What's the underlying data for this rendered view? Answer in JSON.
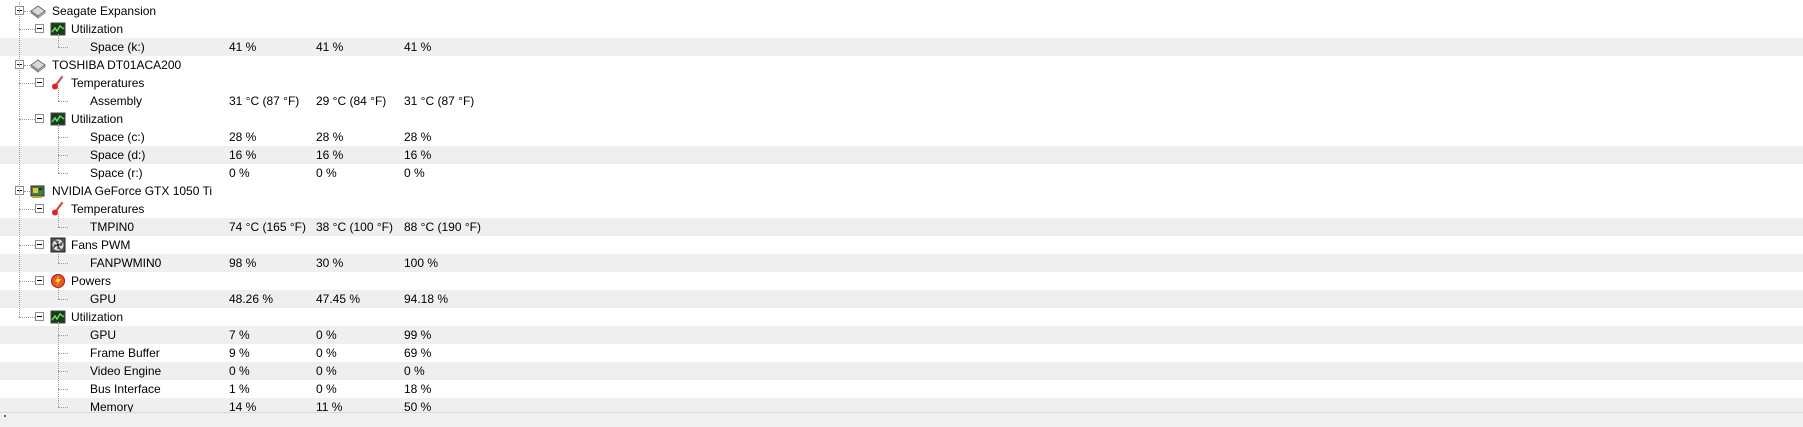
{
  "tree": [
    {
      "label": "Seagate Expansion",
      "level": 0,
      "icon": "drive-icon",
      "expanded": true
    },
    {
      "label": "Utilization",
      "level": 1,
      "icon": "utilization-icon",
      "expanded": true
    },
    {
      "label": "Space (k:)",
      "level": 2,
      "values": [
        "41 %",
        "41 %",
        "41 %"
      ]
    },
    {
      "label": "TOSHIBA DT01ACA200",
      "level": 0,
      "icon": "drive-icon",
      "expanded": true
    },
    {
      "label": "Temperatures",
      "level": 1,
      "icon": "thermometer-icon",
      "expanded": true
    },
    {
      "label": "Assembly",
      "level": 2,
      "values": [
        "31 °C  (87 °F)",
        "29 °C  (84 °F)",
        "31 °C  (87 °F)"
      ]
    },
    {
      "label": "Utilization",
      "level": 1,
      "icon": "utilization-icon",
      "expanded": true
    },
    {
      "label": "Space (c:)",
      "level": 2,
      "values": [
        "28 %",
        "28 %",
        "28 %"
      ]
    },
    {
      "label": "Space (d:)",
      "level": 2,
      "values": [
        "16 %",
        "16 %",
        "16 %"
      ]
    },
    {
      "label": "Space (r:)",
      "level": 2,
      "values": [
        "0 %",
        "0 %",
        "0 %"
      ]
    },
    {
      "label": "NVIDIA GeForce GTX 1050 Ti",
      "level": 0,
      "icon": "gpu-icon",
      "expanded": true
    },
    {
      "label": "Temperatures",
      "level": 1,
      "icon": "thermometer-icon",
      "expanded": true
    },
    {
      "label": "TMPIN0",
      "level": 2,
      "values": [
        "74 °C  (165 °F)",
        "38 °C  (100 °F)",
        "88 °C  (190 °F)"
      ]
    },
    {
      "label": "Fans PWM",
      "level": 1,
      "icon": "fan-icon",
      "expanded": true
    },
    {
      "label": "FANPWMIN0",
      "level": 2,
      "values": [
        "98 %",
        "30 %",
        "100 %"
      ]
    },
    {
      "label": "Powers",
      "level": 1,
      "icon": "power-icon",
      "expanded": true
    },
    {
      "label": "GPU",
      "level": 2,
      "values": [
        "48.26 %",
        "47.45 %",
        "94.18 %"
      ]
    },
    {
      "label": "Utilization",
      "level": 1,
      "icon": "utilization-icon",
      "expanded": true
    },
    {
      "label": "GPU",
      "level": 2,
      "values": [
        "7 %",
        "0 %",
        "99 %"
      ]
    },
    {
      "label": "Frame Buffer",
      "level": 2,
      "values": [
        "9 %",
        "0 %",
        "69 %"
      ]
    },
    {
      "label": "Video Engine",
      "level": 2,
      "values": [
        "0 %",
        "0 %",
        "0 %"
      ]
    },
    {
      "label": "Bus Interface",
      "level": 2,
      "values": [
        "1 %",
        "0 %",
        "18 %"
      ]
    },
    {
      "label": "Memory",
      "level": 2,
      "values": [
        "14 %",
        "11 %",
        "50 %"
      ]
    }
  ],
  "colors": {
    "row_alt": "#efefef",
    "tree_line": "#9a9a9a",
    "background": "#ffffff"
  }
}
